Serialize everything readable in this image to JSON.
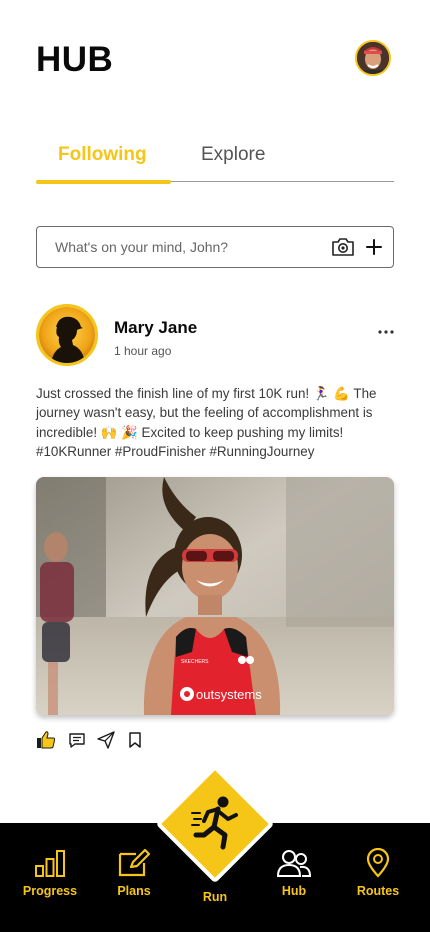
{
  "header": {
    "title": "HUB",
    "avatar": "user-avatar"
  },
  "tabs": [
    {
      "label": "Following",
      "active": true
    },
    {
      "label": "Explore",
      "active": false
    }
  ],
  "composer": {
    "placeholder": "What's on your mind, John?",
    "icons": [
      "camera-icon",
      "plus-icon"
    ]
  },
  "post": {
    "author": "Mary Jane",
    "time": "1 hour ago",
    "text": "Just crossed the finish line of my first 10K run! 🏃‍♀️ 💪 The journey wasn't easy, but the feeling of accomplishment is incredible! 🙌 🎉  Excited to keep pushing my limits! #10KRunner #ProudFinisher #RunningJourney",
    "image": {
      "alt": "Smiling runner in red outsystems top",
      "top_text": "outsystems",
      "left_badge_text": "SKECHERS"
    },
    "actions": [
      "thumbs-up-icon",
      "comment-icon",
      "share-icon",
      "bookmark-icon"
    ]
  },
  "nav": [
    {
      "label": "Progress",
      "icon": "bar-chart-icon",
      "active": false
    },
    {
      "label": "Plans",
      "icon": "edit-icon",
      "active": false
    },
    {
      "label": "Run",
      "icon": "runner-icon",
      "active": false
    },
    {
      "label": "Hub",
      "icon": "users-icon",
      "active": true
    },
    {
      "label": "Routes",
      "icon": "location-pin-icon",
      "active": false
    }
  ],
  "colors": {
    "accent": "#f5c518",
    "nav_bg": "#000000",
    "text": "#111111"
  }
}
